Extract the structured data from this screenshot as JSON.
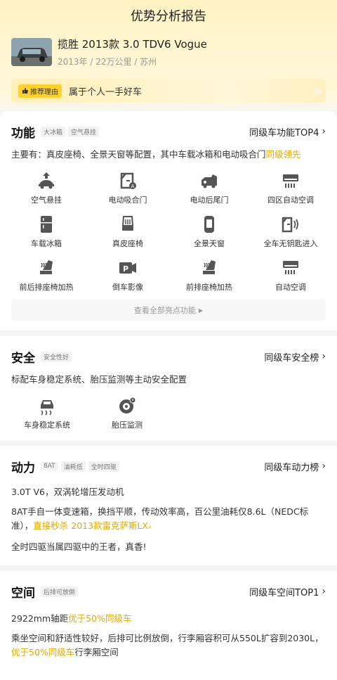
{
  "page": {
    "title": "优势分析报告"
  },
  "car": {
    "name": "揽胜 2013款 3.0 TDV6 Vogue",
    "meta": "2013年 / 22万公里 / 苏州"
  },
  "reason": {
    "tag": "推荐理由",
    "text": "属于个人一手好车"
  },
  "function": {
    "title": "功能",
    "tags": [
      "大冰箱",
      "空气悬挂"
    ],
    "rank": "同级车功能TOP4",
    "desc_prefix": "主要有：真皮座椅、全景天窗等配置，其中车载冰箱和电动吸合门",
    "desc_highlight": "同级领先",
    "features": [
      {
        "label": "空气悬挂",
        "icon": "air-suspension-icon"
      },
      {
        "label": "电动吸合门",
        "icon": "soft-close-door-icon"
      },
      {
        "label": "电动后尾门",
        "icon": "power-tailgate-icon"
      },
      {
        "label": "四区自动空调",
        "icon": "climate-zone-icon"
      },
      {
        "label": "车载冰箱",
        "icon": "fridge-icon"
      },
      {
        "label": "真皮座椅",
        "icon": "leather-seat-icon"
      },
      {
        "label": "全景天窗",
        "icon": "panoramic-roof-icon"
      },
      {
        "label": "全车无钥匙进入",
        "icon": "keyless-entry-icon"
      },
      {
        "label": "前后排座椅加热",
        "icon": "seat-heat-icon"
      },
      {
        "label": "倒车影像",
        "icon": "parking-camera-icon"
      },
      {
        "label": "前排座椅加热",
        "icon": "seat-heat-icon"
      },
      {
        "label": "自动空调",
        "icon": "auto-ac-icon"
      }
    ],
    "more_label": "查看全部亮点功能"
  },
  "safety": {
    "title": "安全",
    "tags": [
      "安全性好"
    ],
    "rank": "同级车安全榜",
    "desc": "标配车身稳定系统、胎压监测等主动安全配置",
    "features": [
      {
        "label": "车身稳定系统",
        "icon": "stability-control-icon"
      },
      {
        "label": "胎压监测",
        "icon": "tire-pressure-icon"
      }
    ]
  },
  "power": {
    "title": "动力",
    "tags": [
      "8AT",
      "油耗低",
      "全时四驱"
    ],
    "rank": "同级车动力榜",
    "line1": "3.0T V6，双涡轮增压发动机",
    "line2_prefix": "8AT手自一体变速箱，换挡平顺，传动效率高，百公里油耗仅8.6L（NEDC标准），",
    "line2_highlight": "直接秒杀 2013款雷克萨斯LX",
    "line3": "全时四驱当属四驱中的王者，真香!"
  },
  "space": {
    "title": "空间",
    "tags": [
      "后排可放倒"
    ],
    "rank": "同级车空间TOP1",
    "line1_prefix": "2922mm轴距",
    "line1_highlight": "优于50%同级车",
    "line2_prefix": "乘坐空间和舒适性较好，后排可比例放倒，行李厢容积可从550L扩容到2030L，",
    "line2_highlight": "优于50%同级车",
    "line2_suffix": "行李厢空间"
  },
  "colors": {
    "accent": "#e0a800",
    "tag_yellow": "#ffd12e",
    "icon": "#555555"
  }
}
